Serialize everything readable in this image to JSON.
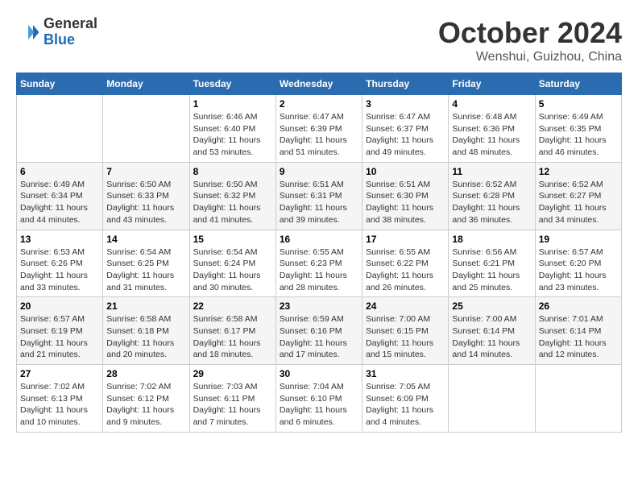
{
  "logo": {
    "general": "General",
    "blue": "Blue"
  },
  "header": {
    "title": "October 2024",
    "location": "Wenshui, Guizhou, China"
  },
  "weekdays": [
    "Sunday",
    "Monday",
    "Tuesday",
    "Wednesday",
    "Thursday",
    "Friday",
    "Saturday"
  ],
  "weeks": [
    [
      {
        "day": "",
        "detail": ""
      },
      {
        "day": "",
        "detail": ""
      },
      {
        "day": "1",
        "detail": "Sunrise: 6:46 AM\nSunset: 6:40 PM\nDaylight: 11 hours and 53 minutes."
      },
      {
        "day": "2",
        "detail": "Sunrise: 6:47 AM\nSunset: 6:39 PM\nDaylight: 11 hours and 51 minutes."
      },
      {
        "day": "3",
        "detail": "Sunrise: 6:47 AM\nSunset: 6:37 PM\nDaylight: 11 hours and 49 minutes."
      },
      {
        "day": "4",
        "detail": "Sunrise: 6:48 AM\nSunset: 6:36 PM\nDaylight: 11 hours and 48 minutes."
      },
      {
        "day": "5",
        "detail": "Sunrise: 6:49 AM\nSunset: 6:35 PM\nDaylight: 11 hours and 46 minutes."
      }
    ],
    [
      {
        "day": "6",
        "detail": "Sunrise: 6:49 AM\nSunset: 6:34 PM\nDaylight: 11 hours and 44 minutes."
      },
      {
        "day": "7",
        "detail": "Sunrise: 6:50 AM\nSunset: 6:33 PM\nDaylight: 11 hours and 43 minutes."
      },
      {
        "day": "8",
        "detail": "Sunrise: 6:50 AM\nSunset: 6:32 PM\nDaylight: 11 hours and 41 minutes."
      },
      {
        "day": "9",
        "detail": "Sunrise: 6:51 AM\nSunset: 6:31 PM\nDaylight: 11 hours and 39 minutes."
      },
      {
        "day": "10",
        "detail": "Sunrise: 6:51 AM\nSunset: 6:30 PM\nDaylight: 11 hours and 38 minutes."
      },
      {
        "day": "11",
        "detail": "Sunrise: 6:52 AM\nSunset: 6:28 PM\nDaylight: 11 hours and 36 minutes."
      },
      {
        "day": "12",
        "detail": "Sunrise: 6:52 AM\nSunset: 6:27 PM\nDaylight: 11 hours and 34 minutes."
      }
    ],
    [
      {
        "day": "13",
        "detail": "Sunrise: 6:53 AM\nSunset: 6:26 PM\nDaylight: 11 hours and 33 minutes."
      },
      {
        "day": "14",
        "detail": "Sunrise: 6:54 AM\nSunset: 6:25 PM\nDaylight: 11 hours and 31 minutes."
      },
      {
        "day": "15",
        "detail": "Sunrise: 6:54 AM\nSunset: 6:24 PM\nDaylight: 11 hours and 30 minutes."
      },
      {
        "day": "16",
        "detail": "Sunrise: 6:55 AM\nSunset: 6:23 PM\nDaylight: 11 hours and 28 minutes."
      },
      {
        "day": "17",
        "detail": "Sunrise: 6:55 AM\nSunset: 6:22 PM\nDaylight: 11 hours and 26 minutes."
      },
      {
        "day": "18",
        "detail": "Sunrise: 6:56 AM\nSunset: 6:21 PM\nDaylight: 11 hours and 25 minutes."
      },
      {
        "day": "19",
        "detail": "Sunrise: 6:57 AM\nSunset: 6:20 PM\nDaylight: 11 hours and 23 minutes."
      }
    ],
    [
      {
        "day": "20",
        "detail": "Sunrise: 6:57 AM\nSunset: 6:19 PM\nDaylight: 11 hours and 21 minutes."
      },
      {
        "day": "21",
        "detail": "Sunrise: 6:58 AM\nSunset: 6:18 PM\nDaylight: 11 hours and 20 minutes."
      },
      {
        "day": "22",
        "detail": "Sunrise: 6:58 AM\nSunset: 6:17 PM\nDaylight: 11 hours and 18 minutes."
      },
      {
        "day": "23",
        "detail": "Sunrise: 6:59 AM\nSunset: 6:16 PM\nDaylight: 11 hours and 17 minutes."
      },
      {
        "day": "24",
        "detail": "Sunrise: 7:00 AM\nSunset: 6:15 PM\nDaylight: 11 hours and 15 minutes."
      },
      {
        "day": "25",
        "detail": "Sunrise: 7:00 AM\nSunset: 6:14 PM\nDaylight: 11 hours and 14 minutes."
      },
      {
        "day": "26",
        "detail": "Sunrise: 7:01 AM\nSunset: 6:14 PM\nDaylight: 11 hours and 12 minutes."
      }
    ],
    [
      {
        "day": "27",
        "detail": "Sunrise: 7:02 AM\nSunset: 6:13 PM\nDaylight: 11 hours and 10 minutes."
      },
      {
        "day": "28",
        "detail": "Sunrise: 7:02 AM\nSunset: 6:12 PM\nDaylight: 11 hours and 9 minutes."
      },
      {
        "day": "29",
        "detail": "Sunrise: 7:03 AM\nSunset: 6:11 PM\nDaylight: 11 hours and 7 minutes."
      },
      {
        "day": "30",
        "detail": "Sunrise: 7:04 AM\nSunset: 6:10 PM\nDaylight: 11 hours and 6 minutes."
      },
      {
        "day": "31",
        "detail": "Sunrise: 7:05 AM\nSunset: 6:09 PM\nDaylight: 11 hours and 4 minutes."
      },
      {
        "day": "",
        "detail": ""
      },
      {
        "day": "",
        "detail": ""
      }
    ]
  ]
}
